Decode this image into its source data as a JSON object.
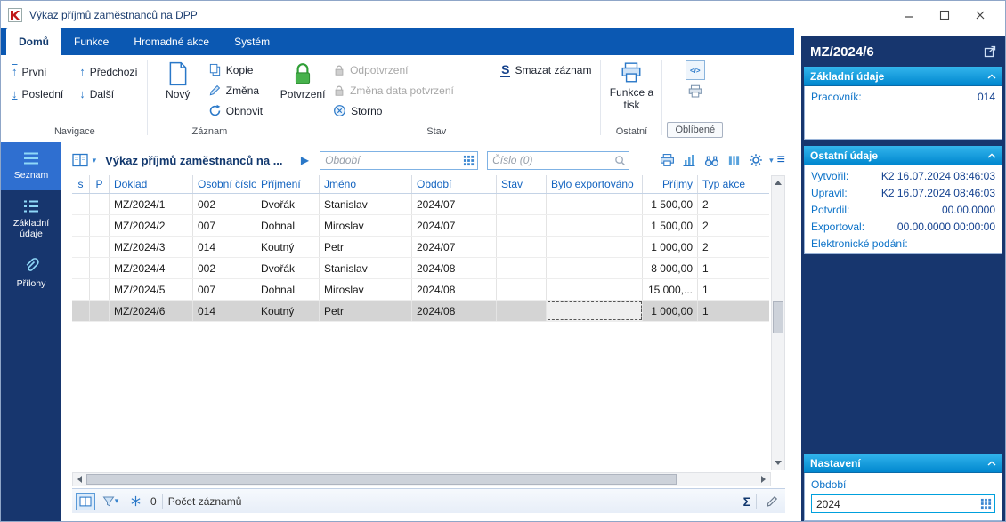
{
  "window": {
    "title": "Výkaz příjmů zaměstnanců na DPP"
  },
  "ribbon": {
    "tabs": [
      {
        "label": "Domů",
        "active": true
      },
      {
        "label": "Funkce",
        "active": false
      },
      {
        "label": "Hromadné akce",
        "active": false
      },
      {
        "label": "Systém",
        "active": false
      }
    ],
    "groups": {
      "navigace": {
        "label": "Navigace",
        "first": "První",
        "previous": "Předchozí",
        "last": "Poslední",
        "next": "Další"
      },
      "zaznam": {
        "label": "Záznam",
        "new": "Nový",
        "copy": "Kopie",
        "change": "Změna",
        "refresh": "Obnovit"
      },
      "stav": {
        "label": "Stav",
        "confirm": "Potvrzení",
        "unconfirm": "Odpotvrzení",
        "change_confirm_date": "Změna data potvrzení",
        "storno": "Storno",
        "delete_record": "Smazat záznam"
      },
      "ostatni": {
        "label": "Ostatní",
        "functions_and_print": "Funkce a tisk"
      },
      "oblibene": {
        "label": "Oblíbené"
      }
    }
  },
  "sidebar": {
    "items": [
      {
        "label": "Seznam",
        "active": true
      },
      {
        "label": "Základní údaje",
        "active": false
      },
      {
        "label": "Přílohy",
        "active": false
      }
    ]
  },
  "toolbar": {
    "list_title": "Výkaz příjmů zaměstnanců na ...",
    "period_filter": {
      "placeholder": "Období"
    },
    "search": {
      "placeholder": "Číslo (0)"
    }
  },
  "table": {
    "columns": [
      "s",
      "P",
      "Doklad",
      "Osobní číslo",
      "Příjmení",
      "Jméno",
      "Období",
      "Stav",
      "Bylo exportováno",
      "Příjmy",
      "Typ akce"
    ],
    "rows": [
      [
        "",
        "",
        "MZ/2024/1",
        "002",
        "Dvořák",
        "Stanislav",
        "2024/07",
        "",
        "",
        "1 500,00",
        "2"
      ],
      [
        "",
        "",
        "MZ/2024/2",
        "007",
        "Dohnal",
        "Miroslav",
        "2024/07",
        "",
        "",
        "1 500,00",
        "2"
      ],
      [
        "",
        "",
        "MZ/2024/3",
        "014",
        "Koutný",
        "Petr",
        "2024/07",
        "",
        "",
        "1 000,00",
        "2"
      ],
      [
        "",
        "",
        "MZ/2024/4",
        "002",
        "Dvořák",
        "Stanislav",
        "2024/08",
        "",
        "",
        "8 000,00",
        "1"
      ],
      [
        "",
        "",
        "MZ/2024/5",
        "007",
        "Dohnal",
        "Miroslav",
        "2024/08",
        "",
        "",
        "15 000,...",
        "1"
      ],
      [
        "",
        "",
        "MZ/2024/6",
        "014",
        "Koutný",
        "Petr",
        "2024/08",
        "",
        "",
        "1 000,00",
        "1"
      ]
    ],
    "selected_row_index": 5
  },
  "statusbar": {
    "frozen_count": "0",
    "records_label": "Počet záznamů"
  },
  "detail_panel": {
    "title": "MZ/2024/6",
    "zakladni": {
      "header": "Základní údaje",
      "fields": [
        {
          "label": "Pracovník:",
          "value": "014"
        }
      ]
    },
    "ostatni": {
      "header": "Ostatní údaje",
      "fields": [
        {
          "label": "Vytvořil:",
          "value": "K2 16.07.2024 08:46:03"
        },
        {
          "label": "Upravil:",
          "value": "K2 16.07.2024 08:46:03"
        },
        {
          "label": "Potvrdil:",
          "value": "00.00.0000"
        },
        {
          "label": "Exportoval:",
          "value": "00.00.0000 00:00:00"
        },
        {
          "label": "Elektronické podání:",
          "value": ""
        }
      ]
    },
    "nastaveni": {
      "header": "Nastavení",
      "period_label": "Období",
      "period_value": "2024"
    }
  },
  "icons": {
    "arrow_up": "↑",
    "arrow_down": "↓",
    "dropdown": "▾",
    "play": "▶",
    "sigma": "Σ",
    "menu": "≡",
    "delete_s": "S",
    "code_slash": "</>"
  },
  "colors": {
    "ribbon_blue": "#0b58b2",
    "sidebar_navy": "#17366e",
    "active_item_blue": "#2f6fd0",
    "section_header_blue": "#0096dd",
    "accent_blue": "#1565c0",
    "confirm_green": "#3fae46",
    "selected_row_gray": "#d4d4d4"
  }
}
